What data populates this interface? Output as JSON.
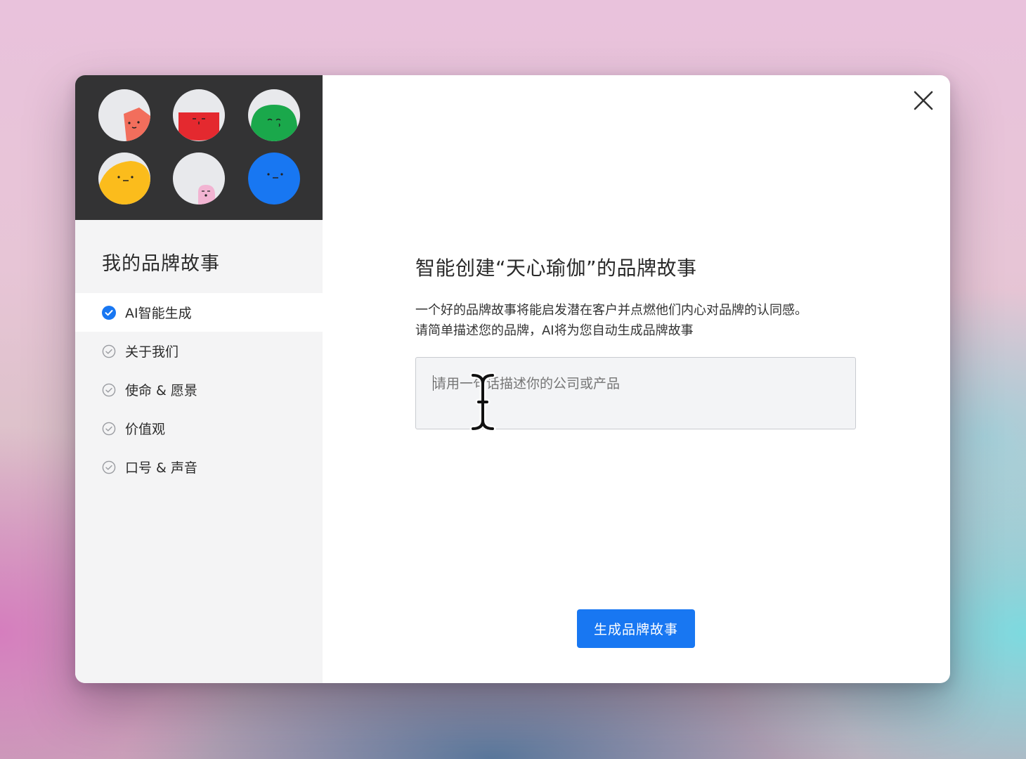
{
  "sidebar": {
    "title": "我的品牌故事",
    "items": [
      {
        "label": "AI智能生成",
        "state": "done",
        "icon": "check-circle-filled-icon"
      },
      {
        "label": "关于我们",
        "state": "pending",
        "icon": "check-circle-outline-icon"
      },
      {
        "label": "使命 & 愿景",
        "state": "pending",
        "icon": "check-circle-outline-icon"
      },
      {
        "label": "价值观",
        "state": "pending",
        "icon": "check-circle-outline-icon"
      },
      {
        "label": "口号 & 声音",
        "state": "pending",
        "icon": "check-circle-outline-icon"
      }
    ]
  },
  "avatars": [
    {
      "name": "coral-avatar",
      "color": "#f26e5c"
    },
    {
      "name": "red-avatar",
      "color": "#e4292f"
    },
    {
      "name": "green-avatar",
      "color": "#1aa84b"
    },
    {
      "name": "yellow-avatar",
      "color": "#fbbc1c"
    },
    {
      "name": "pink-avatar",
      "color": "#f2b4d2"
    },
    {
      "name": "blue-avatar",
      "color": "#1877f2"
    }
  ],
  "main": {
    "heading": "智能创建“天心瑜伽”的品牌故事",
    "description_line1": "一个好的品牌故事将能启发潜在客户并点燃他们内心对品牌的认同感。",
    "description_line2": "请简单描述您的品牌，AI将为您自动生成品牌故事",
    "input": {
      "placeholder": "请用一句话描述你的公司或产品",
      "value": ""
    },
    "submit_label": "生成品牌故事"
  },
  "colors": {
    "accent": "#1877f2",
    "sidebar_bg": "#f4f4f5",
    "avatar_panel_bg": "#333334"
  }
}
